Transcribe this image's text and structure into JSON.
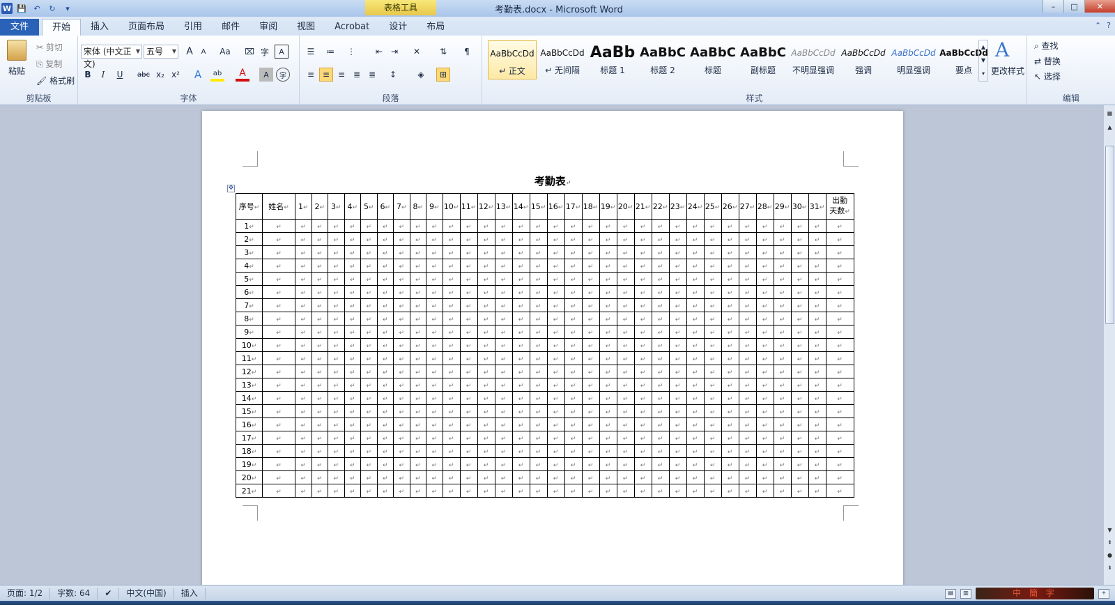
{
  "titlebar": {
    "title": "考勤表.docx - Microsoft Word",
    "contextual_tab": "表格工具",
    "word_logo": "W",
    "window_controls": [
      "–",
      "□",
      "✕"
    ]
  },
  "tabs": [
    "文件",
    "开始",
    "插入",
    "页面布局",
    "引用",
    "邮件",
    "审阅",
    "视图",
    "Acrobat",
    "设计",
    "布局"
  ],
  "ribbon": {
    "clipboard": {
      "paste": "粘贴",
      "cut": "剪切",
      "copy": "复制",
      "format_painter": "格式刷",
      "label": "剪贴板"
    },
    "font": {
      "font_name": "宋体 (中文正文)",
      "font_size": "五号",
      "label": "字体",
      "bold": "B",
      "italic": "I",
      "underline": "U",
      "strike": "abc",
      "sub": "x₂",
      "sup": "x²",
      "grow": "A",
      "shrink": "A",
      "case": "Aa"
    },
    "paragraph": {
      "label": "段落"
    },
    "styles": {
      "label": "样式",
      "items": [
        {
          "sample": "AaBbCcDd",
          "name": "↵ 正文"
        },
        {
          "sample": "AaBbCcDd",
          "name": "↵ 无间隔"
        },
        {
          "sample": "AaBb",
          "name": "标题 1"
        },
        {
          "sample": "AaBbC",
          "name": "标题 2"
        },
        {
          "sample": "AaBbC",
          "name": "标题"
        },
        {
          "sample": "AaBbC",
          "name": "副标题"
        },
        {
          "sample": "AaBbCcDd",
          "name": "不明显强调"
        },
        {
          "sample": "AaBbCcDd",
          "name": "强调"
        },
        {
          "sample": "AaBbCcDd",
          "name": "明显强调"
        },
        {
          "sample": "AaBbCcDd",
          "name": "要点"
        }
      ],
      "change_styles": "更改样式"
    },
    "editing": {
      "find": "查找",
      "replace": "替换",
      "select": "选择",
      "label": "编辑"
    }
  },
  "document": {
    "title": "考勤表",
    "header": {
      "seq": "序号",
      "name": "姓名",
      "days": [
        "1",
        "2",
        "3",
        "4",
        "5",
        "6",
        "7",
        "8",
        "9",
        "10",
        "11",
        "12",
        "13",
        "14",
        "15",
        "16",
        "17",
        "18",
        "19",
        "20",
        "21",
        "22",
        "23",
        "24",
        "25",
        "26",
        "27",
        "28",
        "29",
        "30",
        "31"
      ],
      "attendance_line1": "出勤",
      "attendance_line2": "天数"
    },
    "rows": [
      "1",
      "2",
      "3",
      "4",
      "5",
      "6",
      "7",
      "8",
      "9",
      "10",
      "11",
      "12",
      "13",
      "14",
      "15",
      "16",
      "17",
      "18",
      "19",
      "20",
      "21"
    ],
    "paragraph_mark": "↵"
  },
  "statusbar": {
    "page": "页面: 1/2",
    "words": "字数: 64",
    "language": "中文(中国)",
    "mode": "插入",
    "signature": "中 簡 字"
  }
}
